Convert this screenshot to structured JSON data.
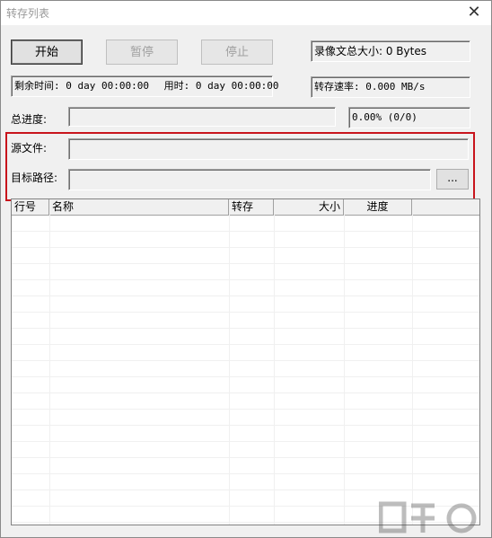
{
  "window": {
    "title": "转存列表",
    "close_glyph": "✕"
  },
  "buttons": {
    "start": "开始",
    "pause": "暂停",
    "stop": "停止",
    "browse": "..."
  },
  "stats": {
    "total_size": "录像文总大小:  0 Bytes",
    "remaining_time": "剩余时间: 0 day 00:00:00",
    "elapsed_time": "用时: 0 day 00:00:00",
    "speed": "转存速率: 0.000 MB/s"
  },
  "progress": {
    "label": "总进度:",
    "value_text": "0.00%  (0/0)",
    "fraction": 0
  },
  "fields": {
    "source_label": "源文件:",
    "target_label": "目标路径:"
  },
  "table": {
    "columns": [
      "行号",
      "名称",
      "转存",
      "大小",
      "进度"
    ]
  },
  "colors": {
    "highlight_border": "#c8141c"
  }
}
